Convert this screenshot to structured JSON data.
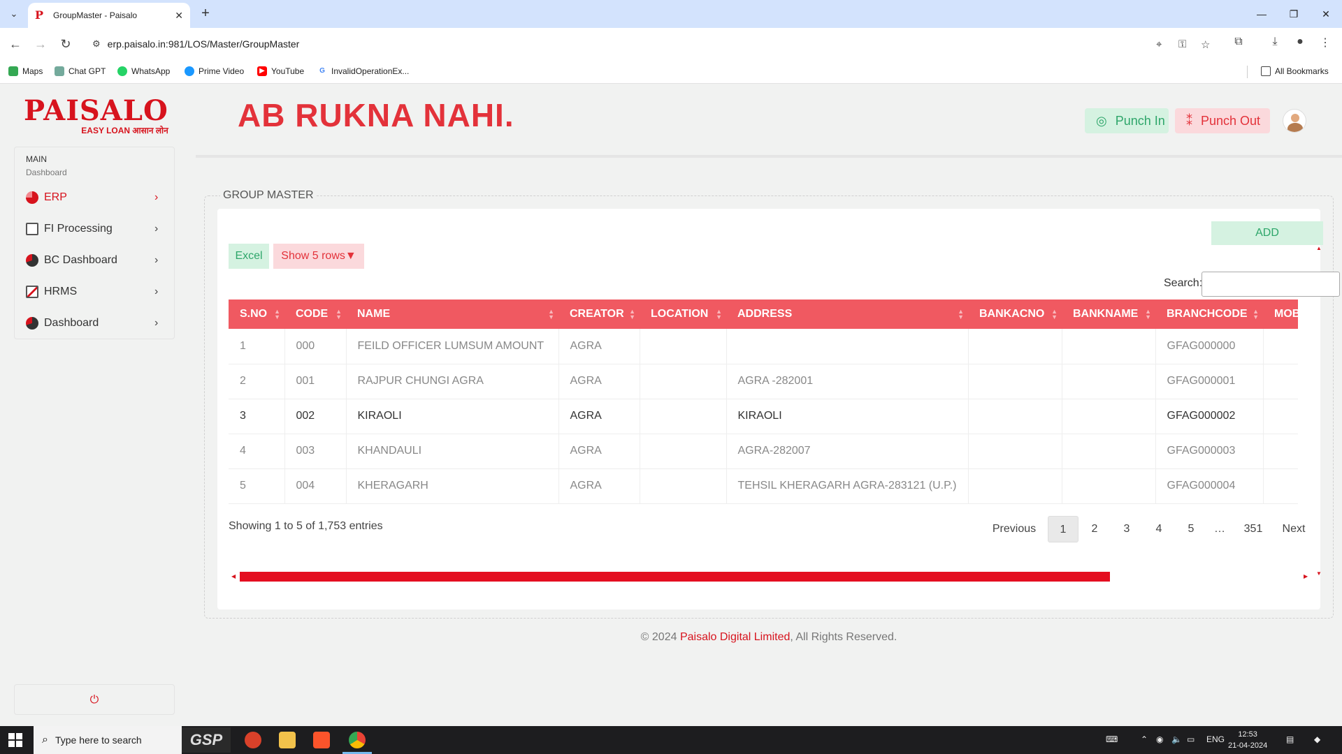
{
  "browser": {
    "tab_title": "GroupMaster - Paisalo",
    "url": "erp.paisalo.in:981/LOS/Master/GroupMaster",
    "bookmarks": [
      "Maps",
      "Chat GPT",
      "WhatsApp",
      "Prime Video",
      "YouTube",
      "InvalidOperationEx...",
      "All Bookmarks"
    ]
  },
  "sidebar": {
    "logo": "PAISALO",
    "tagline": "EASY LOAN आसान लोन",
    "section": "MAIN",
    "subsection": "Dashboard",
    "items": [
      {
        "label": "ERP",
        "icon": "pie-chart-icon"
      },
      {
        "label": "FI Processing",
        "icon": "document-icon"
      },
      {
        "label": "BC Dashboard",
        "icon": "pie-chart-icon"
      },
      {
        "label": "HRMS",
        "icon": "edit-icon"
      },
      {
        "label": "Dashboard",
        "icon": "pie-chart-icon"
      }
    ]
  },
  "header": {
    "slogan": "AB RUKNA NAHI.",
    "punch_in": "Punch In",
    "punch_out": "Punch Out"
  },
  "panel": {
    "title": "GROUP MASTER",
    "add_label": "ADD",
    "excel_label": "Excel",
    "rows_label": "Show 5 rows▼",
    "search_label": "Search:"
  },
  "table": {
    "columns": [
      "S.NO",
      "CODE",
      "NAME",
      "CREATOR",
      "LOCATION",
      "ADDRESS",
      "BANKACNO",
      "BANKNAME",
      "BRANCHCODE",
      "MOBI"
    ],
    "rows": [
      [
        "1",
        "000",
        "FEILD OFFICER LUMSUM AMOUNT",
        "AGRA",
        "",
        "",
        "",
        "",
        "GFAG000000",
        ""
      ],
      [
        "2",
        "001",
        "RAJPUR CHUNGI AGRA",
        "AGRA",
        "",
        "AGRA -282001",
        "",
        "",
        "GFAG000001",
        ""
      ],
      [
        "3",
        "002",
        "KIRAOLI",
        "AGRA",
        "",
        "KIRAOLI",
        "",
        "",
        "GFAG000002",
        ""
      ],
      [
        "4",
        "003",
        "KHANDAULI",
        "AGRA",
        "",
        "AGRA-282007",
        "",
        "",
        "GFAG000003",
        ""
      ],
      [
        "5",
        "004",
        "KHERAGARH",
        "AGRA",
        "",
        "TEHSIL KHERAGARH AGRA-283121 (U.P.)",
        "",
        "",
        "GFAG000004",
        ""
      ]
    ]
  },
  "pagination": {
    "info": "Showing 1 to 5 of 1,753 entries",
    "previous": "Previous",
    "pages": [
      "1",
      "2",
      "3",
      "4",
      "5",
      "…",
      "351"
    ],
    "next": "Next"
  },
  "footer": {
    "prefix": "© 2024 ",
    "brand": "Paisalo Digital Limited",
    "suffix": ", All Rights Reserved."
  },
  "taskbar": {
    "search_placeholder": "Type here to search",
    "gsp": "GSP",
    "lang": "ENG",
    "time": "12:53",
    "date": "21-04-2024"
  },
  "colors": {
    "brand": "#d7131d",
    "table_header": "#f05961",
    "success": "#2ea66a"
  }
}
